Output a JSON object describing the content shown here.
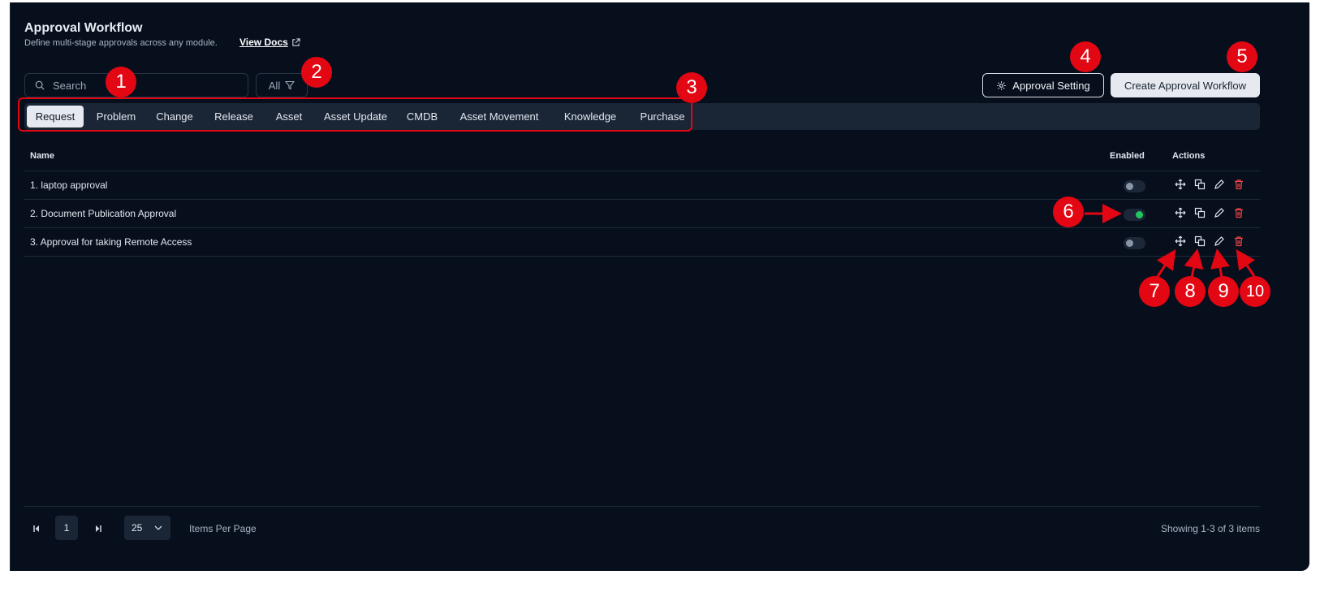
{
  "page": {
    "title": "Approval Workflow",
    "subtitle": "Define multi-stage approvals across any module.",
    "docs_link": "View Docs"
  },
  "toolbar": {
    "search_placeholder": "Search",
    "filter_label": "All",
    "approval_setting_label": "Approval Setting",
    "create_label": "Create Approval Workflow"
  },
  "tabs": [
    {
      "label": "Request",
      "active": true
    },
    {
      "label": "Problem"
    },
    {
      "label": "Change"
    },
    {
      "label": "Release"
    },
    {
      "label": "Asset"
    },
    {
      "label": "Asset Update"
    },
    {
      "label": "CMDB"
    },
    {
      "label": "Asset Movement"
    },
    {
      "label": "Knowledge"
    },
    {
      "label": "Purchase"
    }
  ],
  "table": {
    "columns": [
      "Name",
      "Enabled",
      "Actions"
    ],
    "rows": [
      {
        "name": "1. laptop approval",
        "enabled": false
      },
      {
        "name": "2. Document Publication Approval",
        "enabled": true
      },
      {
        "name": "3. Approval for taking Remote Access",
        "enabled": false
      }
    ],
    "action_icons": [
      "move-icon",
      "duplicate-icon",
      "edit-icon",
      "delete-icon"
    ]
  },
  "pagination": {
    "current_page": "1",
    "page_size": "25",
    "items_per_page_label": "Items Per Page",
    "showing": "Showing 1-3 of 3 items"
  },
  "annotations": [
    "1",
    "2",
    "3",
    "4",
    "5",
    "6",
    "7",
    "8",
    "9",
    "10"
  ],
  "colors": {
    "background": "#070f1d",
    "tab_bar": "#1a2536",
    "toggle_on": "#22c55e",
    "delete": "#ef4444",
    "annotation": "#e30613"
  }
}
